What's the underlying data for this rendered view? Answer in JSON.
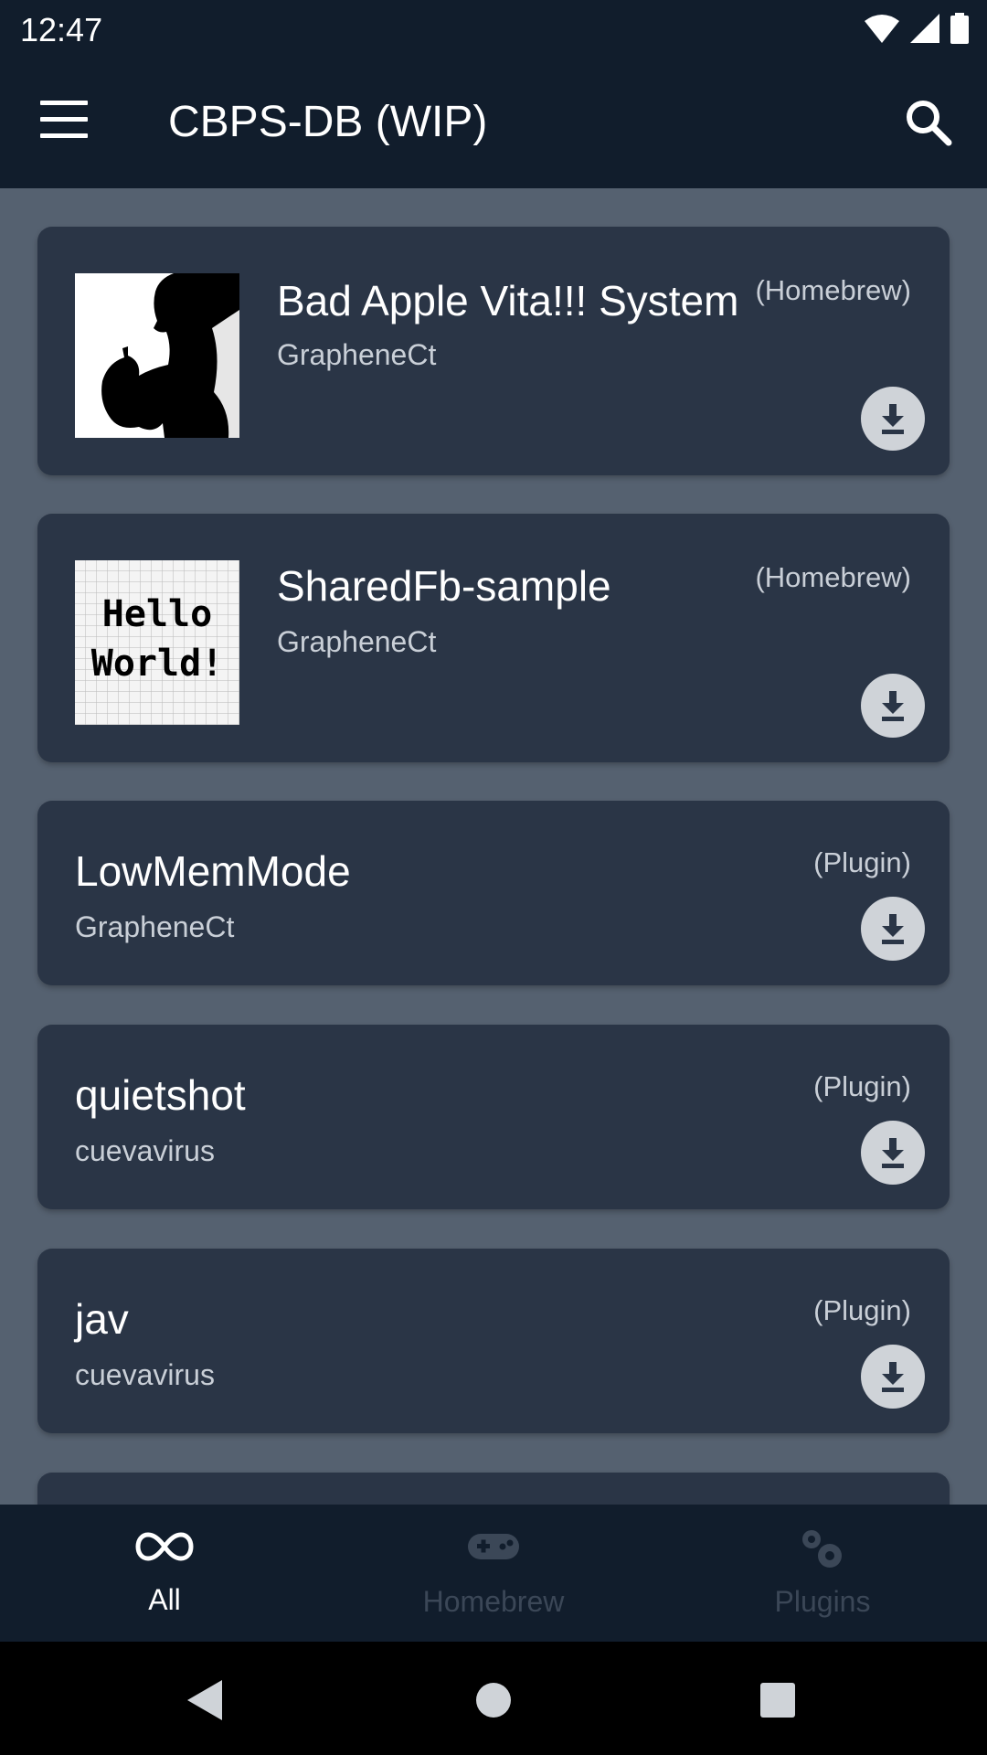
{
  "status_bar": {
    "time": "12:47"
  },
  "app_bar": {
    "title": "CBPS-DB (WIP)",
    "menu_icon": "hamburger-menu-icon",
    "search_icon": "search-icon"
  },
  "items": [
    {
      "title": "Bad Apple Vita!!! System",
      "author": "GrapheneCt",
      "category": "(Homebrew)",
      "thumbnail": "bad-apple-silhouette"
    },
    {
      "title": "SharedFb-sample",
      "author": "GrapheneCt",
      "category": "(Homebrew)",
      "thumbnail": "hello-world-grid",
      "thumb_text_1": "Hello",
      "thumb_text_2": "World!"
    },
    {
      "title": "LowMemMode",
      "author": "GrapheneCt",
      "category": "(Plugin)"
    },
    {
      "title": "quietshot",
      "author": "cuevavirus",
      "category": "(Plugin)"
    },
    {
      "title": "jav",
      "author": "cuevavirus",
      "category": "(Plugin)"
    }
  ],
  "bottom_nav": {
    "items": [
      {
        "label": "All",
        "icon": "infinity-icon",
        "active": true
      },
      {
        "label": "Homebrew",
        "icon": "gamepad-icon",
        "active": false
      },
      {
        "label": "Plugins",
        "icon": "gears-icon",
        "active": false
      }
    ],
    "active_color": "#ffffff",
    "inactive_color": "#3b4757"
  },
  "colors": {
    "background": "#556170",
    "card": "#2a3546",
    "bar": "#111d2c",
    "download_button": "#cfd3d8"
  }
}
